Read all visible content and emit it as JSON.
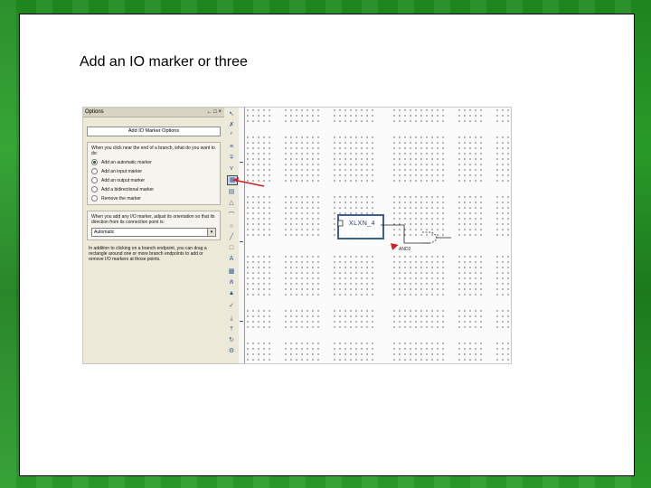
{
  "slide": {
    "title": "Add an IO marker or three"
  },
  "options_panel": {
    "header": "Options",
    "header_controls": "← □ ×",
    "heading_button": "Add IO Marker Options",
    "group1_intro": "When you click near the end of a branch, what do you want to do:",
    "radios": [
      {
        "label": "Add an automatic marker",
        "selected": true
      },
      {
        "label": "Add an input marker",
        "selected": false
      },
      {
        "label": "Add an output marker",
        "selected": false
      },
      {
        "label": "Add a bidirectional marker",
        "selected": false
      },
      {
        "label": "Remove the marker",
        "selected": false
      }
    ],
    "group2_intro": "When you add any I/O marker, adjust its orientation so that its direction from its connection point is:",
    "orientation_value": "Automatic",
    "note": "In addition to clicking on a branch endpoint, you can drag a rectangle around one or more branch endpoints to add or remove I/O markers at those points."
  },
  "schematic": {
    "marker_label": "XLXN_4",
    "gate_label": "AND2"
  },
  "icons": {
    "pointer": "pointer-icon",
    "wire": "wire-icon",
    "io_marker": "io-marker-icon",
    "arc": "arc-icon",
    "circle": "circle-icon",
    "line": "line-icon",
    "rect": "rectangle-icon",
    "text": "text-icon"
  },
  "colors": {
    "accent_green": "#1f8a1f",
    "arrow_red": "#d02020",
    "selection_blue": "#3d5f96"
  }
}
